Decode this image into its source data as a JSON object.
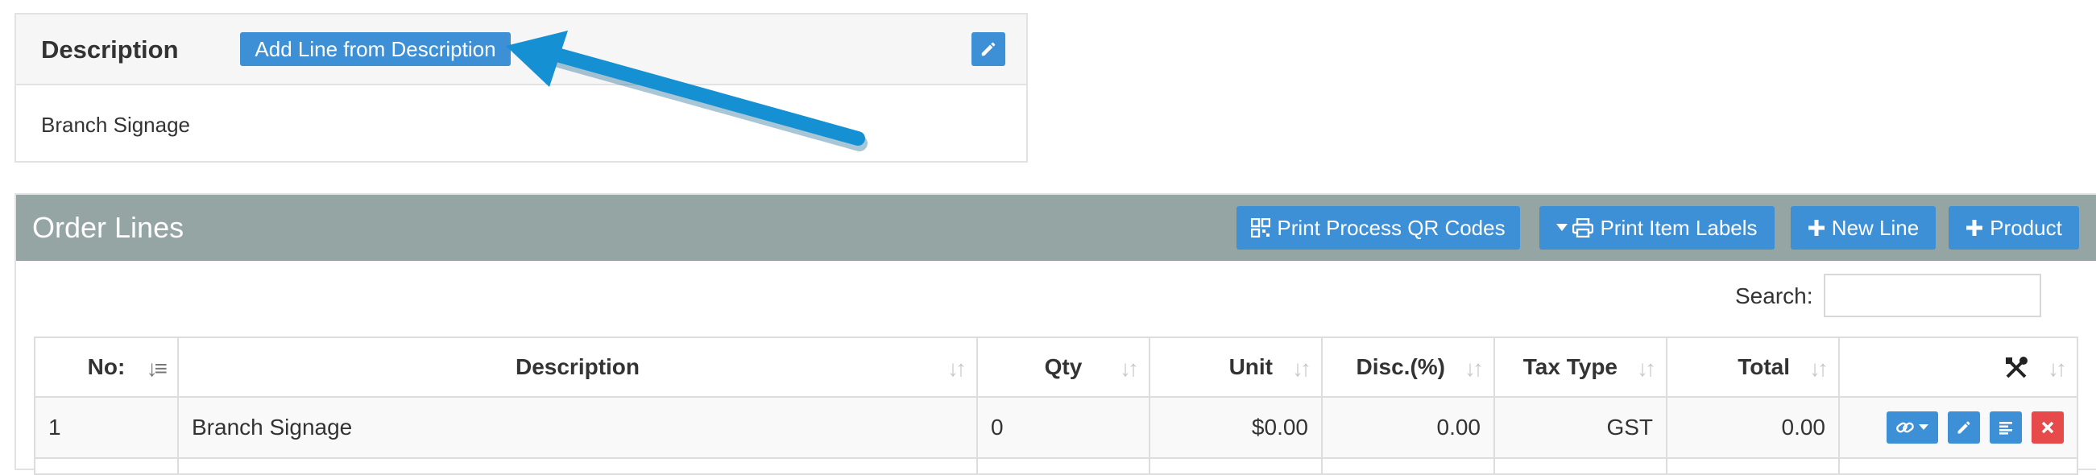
{
  "description_panel": {
    "title": "Description",
    "add_line_button": "Add Line from Description",
    "edit_icon": "pencil-icon",
    "body_text": "Branch Signage"
  },
  "order_lines": {
    "title": "Order Lines",
    "buttons": {
      "print_qr": "Print Process QR Codes",
      "print_labels": "Print Item Labels",
      "new_line": "New Line",
      "product": "Product"
    },
    "search_label": "Search:",
    "search_value": "",
    "columns": {
      "no": "No:",
      "description": "Description",
      "qty": "Qty",
      "unit": "Unit",
      "disc": "Disc.(%)",
      "tax_type": "Tax Type",
      "total": "Total"
    },
    "rows": [
      {
        "no": "1",
        "description": "Branch Signage",
        "qty": "0",
        "unit": "$0.00",
        "disc": "0.00",
        "tax_type": "GST",
        "total": "0.00"
      }
    ]
  },
  "colors": {
    "accent_blue": "#3d8fd6",
    "header_gray": "#95a5a3",
    "delete_red": "#e64a4a",
    "arrow_blue": "#1591d3"
  }
}
